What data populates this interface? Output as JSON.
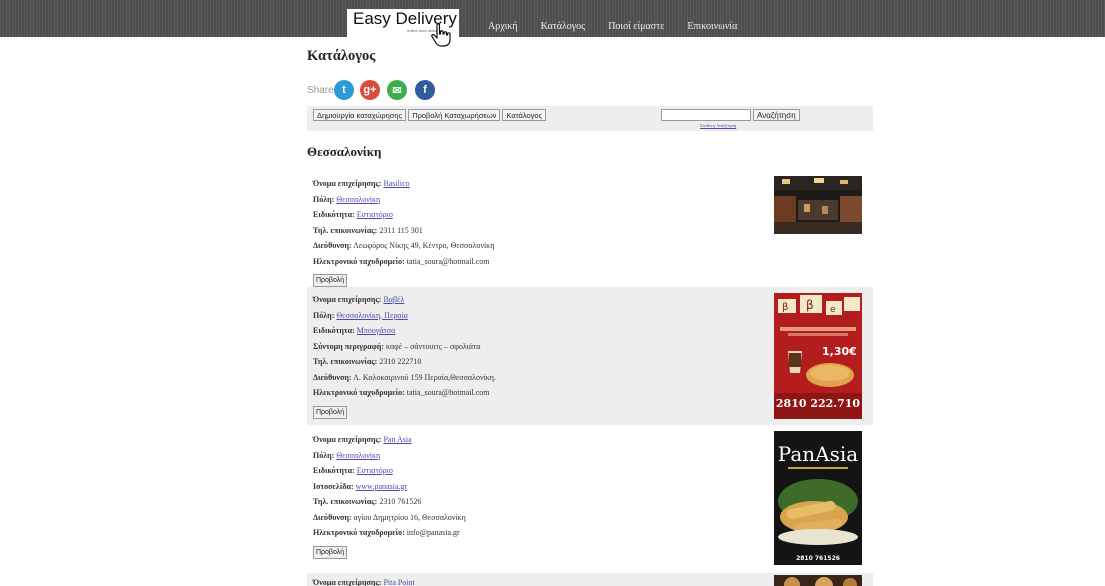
{
  "header": {
    "logo_title": "Easy Delivery",
    "logo_tagline": "online food delivery",
    "nav": [
      "Αρχική",
      "Κατάλογος",
      "Ποιοί είμαστε",
      "Επικοινωνία"
    ]
  },
  "page_title": "Κατάλογος",
  "share": {
    "label": "Share",
    "buttons": [
      {
        "name": "twitter",
        "glyph": "t",
        "color": "#2b9ad6"
      },
      {
        "name": "google-plus",
        "glyph": "g+",
        "color": "#d94b3a"
      },
      {
        "name": "email",
        "glyph": "✉",
        "color": "#3dae4a"
      },
      {
        "name": "facebook",
        "glyph": "f",
        "color": "#2f5a9e"
      }
    ]
  },
  "toolbar": {
    "buttons": [
      "Δημιουργία καταχώρησης",
      "Προβολή Καταχωρήσεων",
      "Κατάλογος"
    ],
    "search_value": "",
    "search_button": "Αναζήτηση",
    "advanced_link": "Σύνθετη Αναζήτηση"
  },
  "city_title": "Θεσσαλονίκη",
  "view_button": "Προβολή",
  "listings": [
    {
      "fields": [
        {
          "label": "Όνομα επιχείρησης:",
          "value": "Basilico",
          "link": true
        },
        {
          "label": "Πόλη:",
          "value": "Θεσσαλονίκη",
          "link": true
        },
        {
          "label": "Ειδικότητα:",
          "value": "Εστιατόριο",
          "link": true
        },
        {
          "label": "Τηλ. επικοινωνίας:",
          "value": "2311 115 301",
          "link": false
        },
        {
          "label": "Διεύθυνση:",
          "value": "Λεωφόρος Νίκης 49, Κέντρο, Θεσσαλονίκη",
          "link": false
        },
        {
          "label": "Ηλεκτρονικό ταχυδρομείο:",
          "value": "tatia_soura@hotmail.com",
          "link": false
        }
      ]
    },
    {
      "fields": [
        {
          "label": "Όνομα επιχείρησης:",
          "value": "Βαβέλ",
          "link": true
        },
        {
          "label": "Πόλη:",
          "value": "Θεσσαλονίκη, Περαία",
          "link": true
        },
        {
          "label": "Ειδικότητα:",
          "value": "Μπουγάτσα",
          "link": true
        },
        {
          "label": "Σύντομη περιγραφή:",
          "value": "καφέ – σάντουιτς – σφολιάτα",
          "link": false
        },
        {
          "label": "Τηλ. επικοινωνίας:",
          "value": "2310 222710",
          "link": false
        },
        {
          "label": "Διεύθυνση:",
          "value": "Λ. Καλοκαιρινού 159 Περαία,Θεσσαλονίκη.",
          "link": false
        },
        {
          "label": "Ηλεκτρονικό ταχυδρομείο:",
          "value": "tatia_soura@hotmail.com",
          "link": false
        }
      ],
      "thumb_text": {
        "price": "1,30€",
        "phone": "2810 222.710"
      }
    },
    {
      "fields": [
        {
          "label": "Όνομα επιχείρησης:",
          "value": "Pan Asia",
          "link": true
        },
        {
          "label": "Πόλη:",
          "value": "Θεσσαλονίκη",
          "link": true
        },
        {
          "label": "Ειδικότητα:",
          "value": "Εστιατόριο",
          "link": true
        },
        {
          "label": "Ιστοσελίδα:",
          "value": "www.panasia.gr",
          "link": true
        },
        {
          "label": "Τηλ. επικοινωνίας:",
          "value": "2310 761526",
          "link": false
        },
        {
          "label": "Διεύθυνση:",
          "value": "αγίου Δημητρίου 16, Θεσσαλονίκη",
          "link": false
        },
        {
          "label": "Ηλεκτρονικό ταχυδρομείο:",
          "value": "info@panasia.gr",
          "link": false
        }
      ],
      "thumb_text": {
        "brand": "PanAsia",
        "phone": "2810 761526"
      }
    },
    {
      "fields": [
        {
          "label": "Όνομα επιχείρησης:",
          "value": "Pita Point",
          "link": true
        }
      ]
    }
  ]
}
